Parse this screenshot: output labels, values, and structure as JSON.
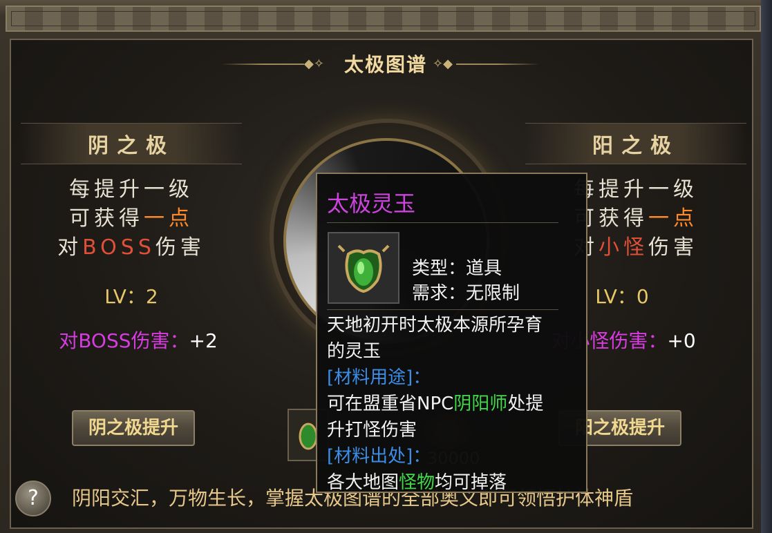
{
  "panel": {
    "title": "太极图谱"
  },
  "yin": {
    "title": "阴之极",
    "desc_line1": "每提升一级",
    "desc_line2_a": "可获得",
    "desc_line2_b": "一点",
    "desc_line3_a": "对",
    "desc_line3_b": "BOSS",
    "desc_line3_c": "伤害",
    "lv": "LV：2",
    "dmg_label": "对BOSS伤害：",
    "dmg_value": "+2",
    "button": "阴之极提升"
  },
  "yang": {
    "title": "阳之极",
    "desc_line1": "每提升一级",
    "desc_line2_a": "可获得",
    "desc_line2_b": "一点",
    "desc_line3_a": "对",
    "desc_line3_b": "小怪",
    "desc_line3_c": "伤害",
    "lv": "LV：0",
    "dmg_label": "对小怪伤害：",
    "dmg_value": "+0",
    "button": "阳之极提升"
  },
  "cost": "30000",
  "footer": {
    "text": "阴阳交汇，万物生长，掌握太极图谱的全部奥义即可领悟护体神盾",
    "help": "?"
  },
  "tooltip": {
    "title": "太极灵玉",
    "type": "类型：道具",
    "requirement": "需求：无限制",
    "desc1": "天地初开时太极本源所孕育",
    "desc2": "的灵玉",
    "usage_header": "[材料用途]：",
    "usage_a": "可在盟重省NPC",
    "usage_npc": "阴阳师",
    "usage_b": "处提",
    "usage_c": "升打怪伤害",
    "source_header": "[材料出处]：",
    "source_a": "各大地图",
    "source_monster": "怪物",
    "source_b": "均可掉落"
  },
  "colors": {
    "title_gold": "#f1d9a0",
    "highlight_orange": "#ff8a2a",
    "highlight_red": "#e05038",
    "level_gold": "#e9c766",
    "purple": "#d83be0",
    "tooltip_blue": "#3b8ee8",
    "tooltip_green": "#3fd94a"
  }
}
